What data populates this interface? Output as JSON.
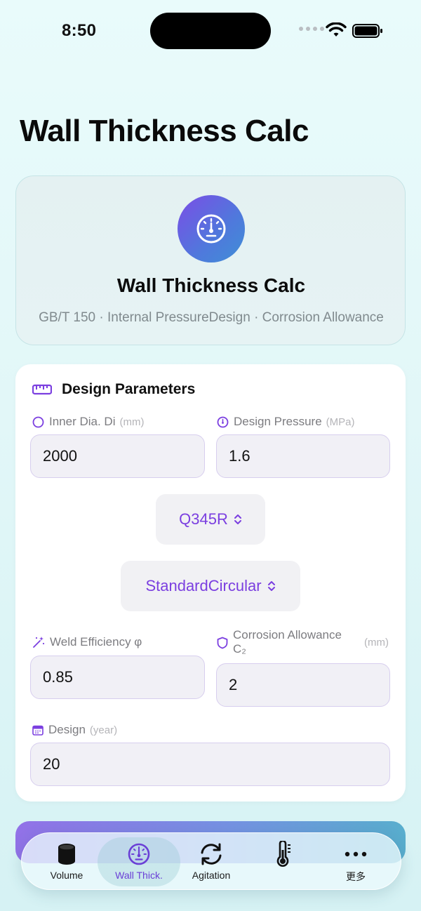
{
  "status_bar": {
    "time": "8:50"
  },
  "page": {
    "title": "Wall Thickness Calc"
  },
  "hero": {
    "icon": "gauge-icon",
    "title": "Wall Thickness Calc",
    "subtitle": "GB/T 150 · Internal PressureDesign · Corrosion Allowance"
  },
  "params": {
    "section_title": "Design Parameters",
    "section_icon": "ruler-icon",
    "inner_dia": {
      "label": "Inner Dia. Di",
      "unit": "(mm)",
      "value": "2000",
      "icon": "circle-icon"
    },
    "design_pressure": {
      "label": "Design Pressure",
      "unit": "(MPa)",
      "value": "1.6",
      "icon": "gauge-icon"
    },
    "material_picker": {
      "value": "Q345R",
      "icon": "chevron-updown-icon"
    },
    "head_type_picker": {
      "value": "StandardCircular",
      "icon": "chevron-updown-icon"
    },
    "weld_efficiency": {
      "label": "Weld Efficiency φ",
      "value": "0.85",
      "icon": "sparkle-wand-icon"
    },
    "corrosion_allowance": {
      "label": "Corrosion Allowance",
      "label_sub": "C₂",
      "unit": "(mm)",
      "value": "2",
      "icon": "shield-icon"
    },
    "design_life": {
      "label": "Design",
      "unit": "(year)",
      "value": "20",
      "icon": "calendar-icon"
    }
  },
  "tab_bar": {
    "active": "Wall Thick.",
    "tabs": [
      {
        "label": "Volume",
        "icon": "cylinder-icon"
      },
      {
        "label": "Wall Thick.",
        "icon": "gauge-icon"
      },
      {
        "label": "Agitation",
        "icon": "rotate-arrows-icon"
      },
      {
        "label": "",
        "icon": "thermometer-icon"
      },
      {
        "label": "更多",
        "icon": "ellipsis-icon"
      }
    ]
  },
  "colors": {
    "accent": "#7b3fe0",
    "hero_gradient_start": "#7b4de6",
    "hero_gradient_end": "#3f8fd6",
    "input_border": "#d7ceee",
    "background": "#e2f7f8"
  }
}
